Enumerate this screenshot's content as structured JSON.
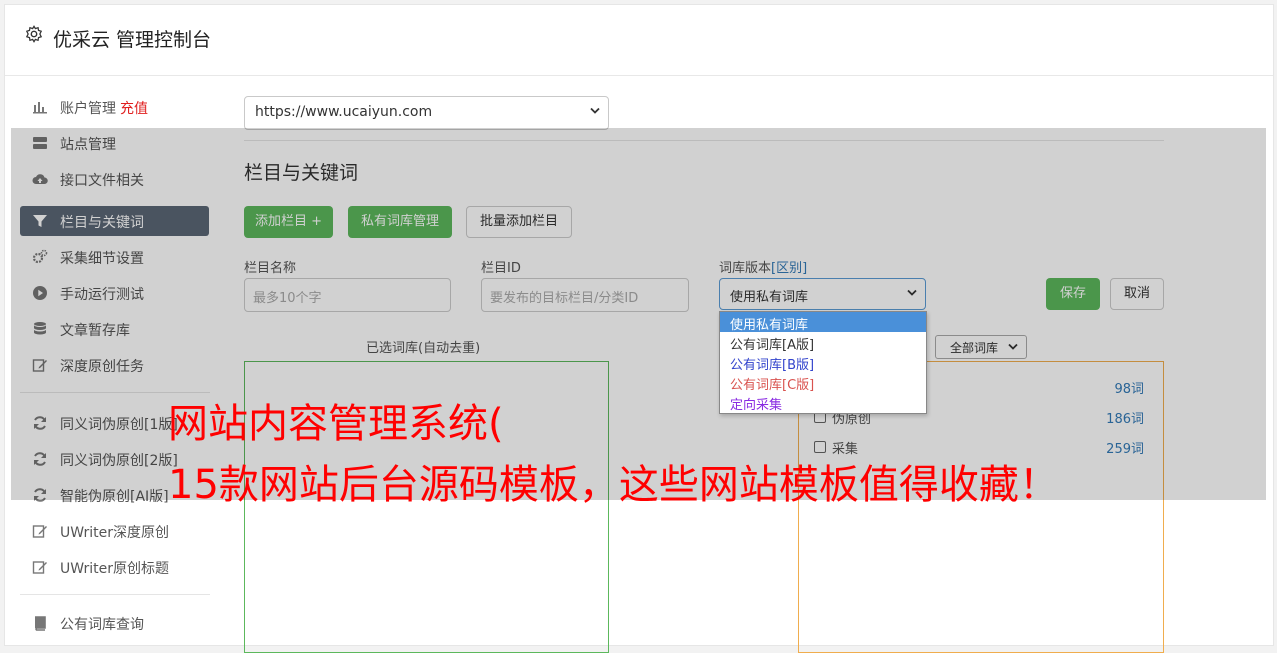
{
  "header": {
    "title": "优采云 管理控制台"
  },
  "sidebar": {
    "items": [
      {
        "label": "账户管理",
        "badge": "充值",
        "icon": "bar-chart-icon"
      },
      {
        "label": "站点管理",
        "icon": "server-icon"
      },
      {
        "label": "接口文件相关",
        "icon": "cloud-upload-icon"
      },
      {
        "label": "栏目与关键词",
        "icon": "filter-icon"
      },
      {
        "label": "采集细节设置",
        "icon": "cogs-icon"
      },
      {
        "label": "手动运行测试",
        "icon": "play-icon"
      },
      {
        "label": "文章暂存库",
        "icon": "database-icon"
      },
      {
        "label": "深度原创任务",
        "icon": "edit-icon"
      },
      {
        "label": "同义词伪原创[1版]",
        "icon": "refresh-icon"
      },
      {
        "label": "同义词伪原创[2版]",
        "icon": "refresh-icon"
      },
      {
        "label": "智能伪原创[AI版]",
        "icon": "refresh-icon"
      },
      {
        "label": "UWriter深度原创",
        "icon": "edit-icon"
      },
      {
        "label": "UWriter原创标题",
        "icon": "edit-icon"
      },
      {
        "label": "公有词库查询",
        "icon": "book-icon"
      }
    ]
  },
  "site_select": {
    "value": "https://www.ucaiyun.com"
  },
  "section": {
    "title": "栏目与关键词"
  },
  "buttons": {
    "add_column": "添加栏目 +",
    "private_lib": "私有词库管理",
    "batch_add": "批量添加栏目",
    "save": "保存",
    "cancel": "取消"
  },
  "form": {
    "column_name_label": "栏目名称",
    "column_name_placeholder": "最多10个字",
    "column_id_label": "栏目ID",
    "column_id_placeholder": "要发布的目标栏目/分类ID",
    "lib_version_label": "词库版本",
    "lib_version_link": "[区别]",
    "lib_version_value": "使用私有词库"
  },
  "dropdown": {
    "options": [
      {
        "label": "使用私有词库",
        "color": "#ffffff"
      },
      {
        "label": "公有词库[A版]",
        "color": "#333333"
      },
      {
        "label": "公有词库[B版]",
        "color": "#3344cc"
      },
      {
        "label": "公有词库[C版]",
        "color": "#d9534f"
      },
      {
        "label": "定向采集",
        "color": "#8a2be2"
      }
    ]
  },
  "selected_box": {
    "caption": "已选词库(自动去重)"
  },
  "category_select": {
    "value": "全部词库"
  },
  "libraries": [
    {
      "name": "",
      "count": "98词"
    },
    {
      "name": "伪原创",
      "count": "186词"
    },
    {
      "name": "采集",
      "count": "259词"
    }
  ],
  "watermark": {
    "line1": "网站内容管理系统(",
    "line2": "15款网站后台源码模板，这些网站模板值得收藏！"
  },
  "colors": {
    "primary_green": "#5cb85c",
    "sidebar_active": "#5b6776",
    "watermark_red": "#ff0000"
  }
}
